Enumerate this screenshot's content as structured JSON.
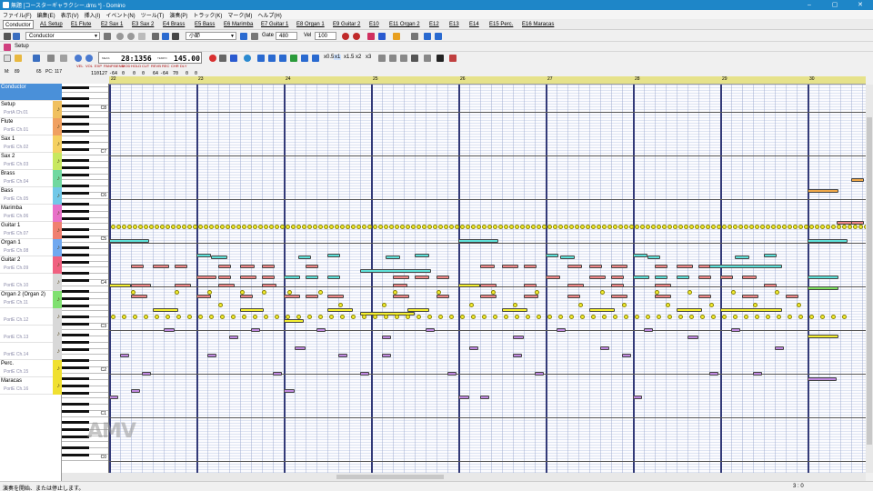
{
  "window": {
    "title": "無題 [コースターギャラクシー.dms *] - Domino",
    "controls": [
      "–",
      "▢",
      "✕"
    ]
  },
  "menu": [
    "ファイル(F)",
    "編集(E)",
    "表示(V)",
    "挿入(I)",
    "イベント(N)",
    "ツール(T)",
    "演奏(P)",
    "トラック(K)",
    "マーク(M)",
    "ヘルプ(H)"
  ],
  "tracks_tabs": [
    "Conductor",
    "A1 Setup",
    "E1 Flute",
    "E2 Sax 1",
    "E3 Sax 2",
    "E4 Brass",
    "E5 Bass",
    "E6 Marimba",
    "E7 Guitar 1",
    "E8 Organ 1",
    "E9 Guitar 2",
    "E10",
    "E11 Organ 2",
    "E12",
    "E13",
    "E14",
    "E15 Perc.",
    "E16 Maracas"
  ],
  "toolbar": {
    "track_combo": "Conductor",
    "snap_combo": "小節",
    "gate_label": "Gate",
    "gate_value": "480",
    "vel_label": "Vel",
    "vel_value": "100",
    "setup_label": "Setup",
    "zoom_buttons": [
      "x0.5",
      "x1",
      "x1.5",
      "x2",
      "x3"
    ]
  },
  "transport": {
    "meas_label": "MEAS",
    "position": "28:1356",
    "tempo_label": "TEMPO",
    "tempo": "145.00"
  },
  "mixer": {
    "headers": [
      "VEL",
      "VOL",
      "EXP",
      "PAN",
      "P.BEND",
      "MOD",
      "HOLD",
      "CUT",
      "REVB",
      "REC",
      "CHR",
      "DLY"
    ],
    "values": [
      "110",
      "127",
      "-64",
      "0",
      "0",
      "0",
      "64",
      "-64",
      "70",
      "0",
      "0"
    ]
  },
  "keyboard_header": {
    "numbers": [
      "89",
      "65",
      "117"
    ],
    "labels": [
      "M:",
      "PC:"
    ]
  },
  "track_list": [
    {
      "name": "Conductor",
      "port": "",
      "color": "#4a90d9",
      "selected": true
    },
    {
      "name": "Setup",
      "port": "PortA Ch.01",
      "color": "#f0c060"
    },
    {
      "name": "Flute",
      "port": "PortE Ch.01",
      "color": "#f0a060"
    },
    {
      "name": "Sax 1",
      "port": "PortE Ch.02",
      "color": "#f5d060"
    },
    {
      "name": "Sax 2",
      "port": "PortE Ch.03",
      "color": "#c8e860"
    },
    {
      "name": "Brass",
      "port": "PortE Ch.04",
      "color": "#70d8a0"
    },
    {
      "name": "Bass",
      "port": "PortE Ch.05",
      "color": "#70c8e8"
    },
    {
      "name": "Marimba",
      "port": "PortE Ch.06",
      "color": "#e870c8"
    },
    {
      "name": "Guitar 1",
      "port": "PortE Ch.07",
      "color": "#f08070"
    },
    {
      "name": "Organ 1",
      "port": "PortE Ch.08",
      "color": "#70a8f0"
    },
    {
      "name": "Guitar 2",
      "port": "PortE Ch.09",
      "color": "#f06080"
    },
    {
      "name": "",
      "port": "PortE Ch.10",
      "color": "#d8d8d8"
    },
    {
      "name": "Organ 2 (Organ 2)",
      "port": "PortE Ch.11",
      "color": "#80e070"
    },
    {
      "name": "",
      "port": "PortE Ch.12",
      "color": "#d8d8d8"
    },
    {
      "name": "",
      "port": "PortE Ch.13",
      "color": "#d8d8d8"
    },
    {
      "name": "",
      "port": "PortE Ch.14",
      "color": "#d8d8d8"
    },
    {
      "name": "Perc.",
      "port": "PortE Ch.15",
      "color": "#f0e030"
    },
    {
      "name": "Maracas",
      "port": "PortE Ch.16",
      "color": "#f0e030"
    }
  ],
  "ruler_measures": [
    "22",
    "23",
    "24",
    "25",
    "26",
    "27",
    "28",
    "29",
    "30"
  ],
  "octave_labels": [
    "C8",
    "C7",
    "C6",
    "C5",
    "C4",
    "C3",
    "C2",
    "C1",
    "C0"
  ],
  "colors": {
    "titlebar": "#1e86c8",
    "ruler": "#e6e28a",
    "note_cyan": "#5ee0d8",
    "note_red": "#f08888",
    "note_yellow": "#f4ee30",
    "note_purple": "#c088e0",
    "note_orange": "#f0a848",
    "note_green": "#80e060"
  },
  "status": {
    "left": "演奏を開始、または停止します。",
    "right": "3 : 0"
  },
  "watermark": "AMV"
}
